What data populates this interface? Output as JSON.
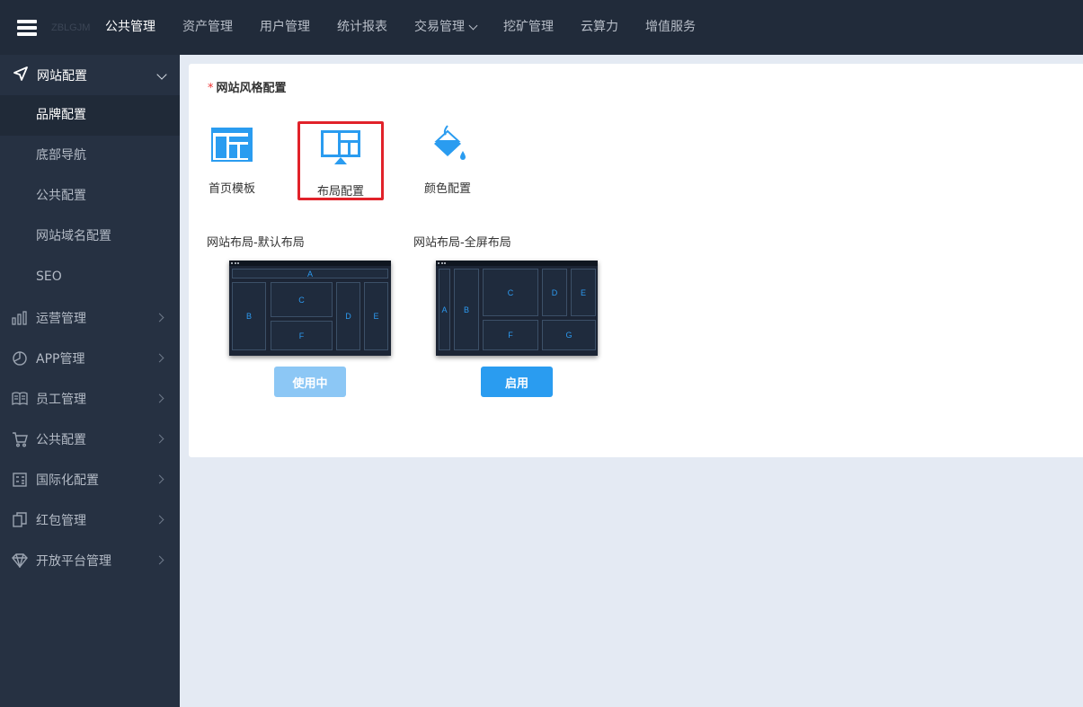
{
  "topbar": {
    "logo_text": "ZBLGJM",
    "nav": [
      {
        "label": "公共管理",
        "active": true
      },
      {
        "label": "资产管理"
      },
      {
        "label": "用户管理"
      },
      {
        "label": "统计报表"
      },
      {
        "label": "交易管理",
        "has_dropdown": true
      },
      {
        "label": "挖矿管理"
      },
      {
        "label": "云算力"
      },
      {
        "label": "增值服务"
      }
    ]
  },
  "sidebar": {
    "head": {
      "label": "网站配置",
      "icon": "navigation-icon"
    },
    "sub_items": [
      {
        "label": "品牌配置",
        "active": true
      },
      {
        "label": "底部导航"
      },
      {
        "label": "公共配置"
      },
      {
        "label": "网站域名配置"
      },
      {
        "label": "SEO"
      }
    ],
    "groups": [
      {
        "label": "运营管理",
        "icon": "bar-chart-icon"
      },
      {
        "label": "APP管理",
        "icon": "pie-chart-icon"
      },
      {
        "label": "员工管理",
        "icon": "book-icon"
      },
      {
        "label": "公共配置",
        "icon": "cart-icon"
      },
      {
        "label": "国际化配置",
        "icon": "calculator-icon"
      },
      {
        "label": "红包管理",
        "icon": "copy-icon"
      },
      {
        "label": "开放平台管理",
        "icon": "diamond-icon"
      }
    ]
  },
  "panel": {
    "required_mark": "*",
    "title": "网站风格配置",
    "style_options": [
      {
        "label": "首页模板",
        "icon": "template-icon"
      },
      {
        "label": "布局配置",
        "icon": "layout-monitor-icon",
        "selected": true
      },
      {
        "label": "颜色配置",
        "icon": "paint-bucket-icon"
      }
    ],
    "layouts": [
      {
        "title": "网站布局-默认布局",
        "blocks": [
          "A",
          "B",
          "C",
          "D",
          "E",
          "F"
        ],
        "button": "使用中",
        "status": "in-use"
      },
      {
        "title": "网站布局-全屏布局",
        "blocks": [
          "A",
          "B",
          "C",
          "D",
          "E",
          "F",
          "G"
        ],
        "button": "启用",
        "status": "enable"
      }
    ]
  },
  "colors": {
    "topbar": "#212b3a",
    "sidebar": "#263142",
    "accent": "#2a9cf0",
    "selected_border": "#e1222a",
    "required": "#ee3333"
  }
}
